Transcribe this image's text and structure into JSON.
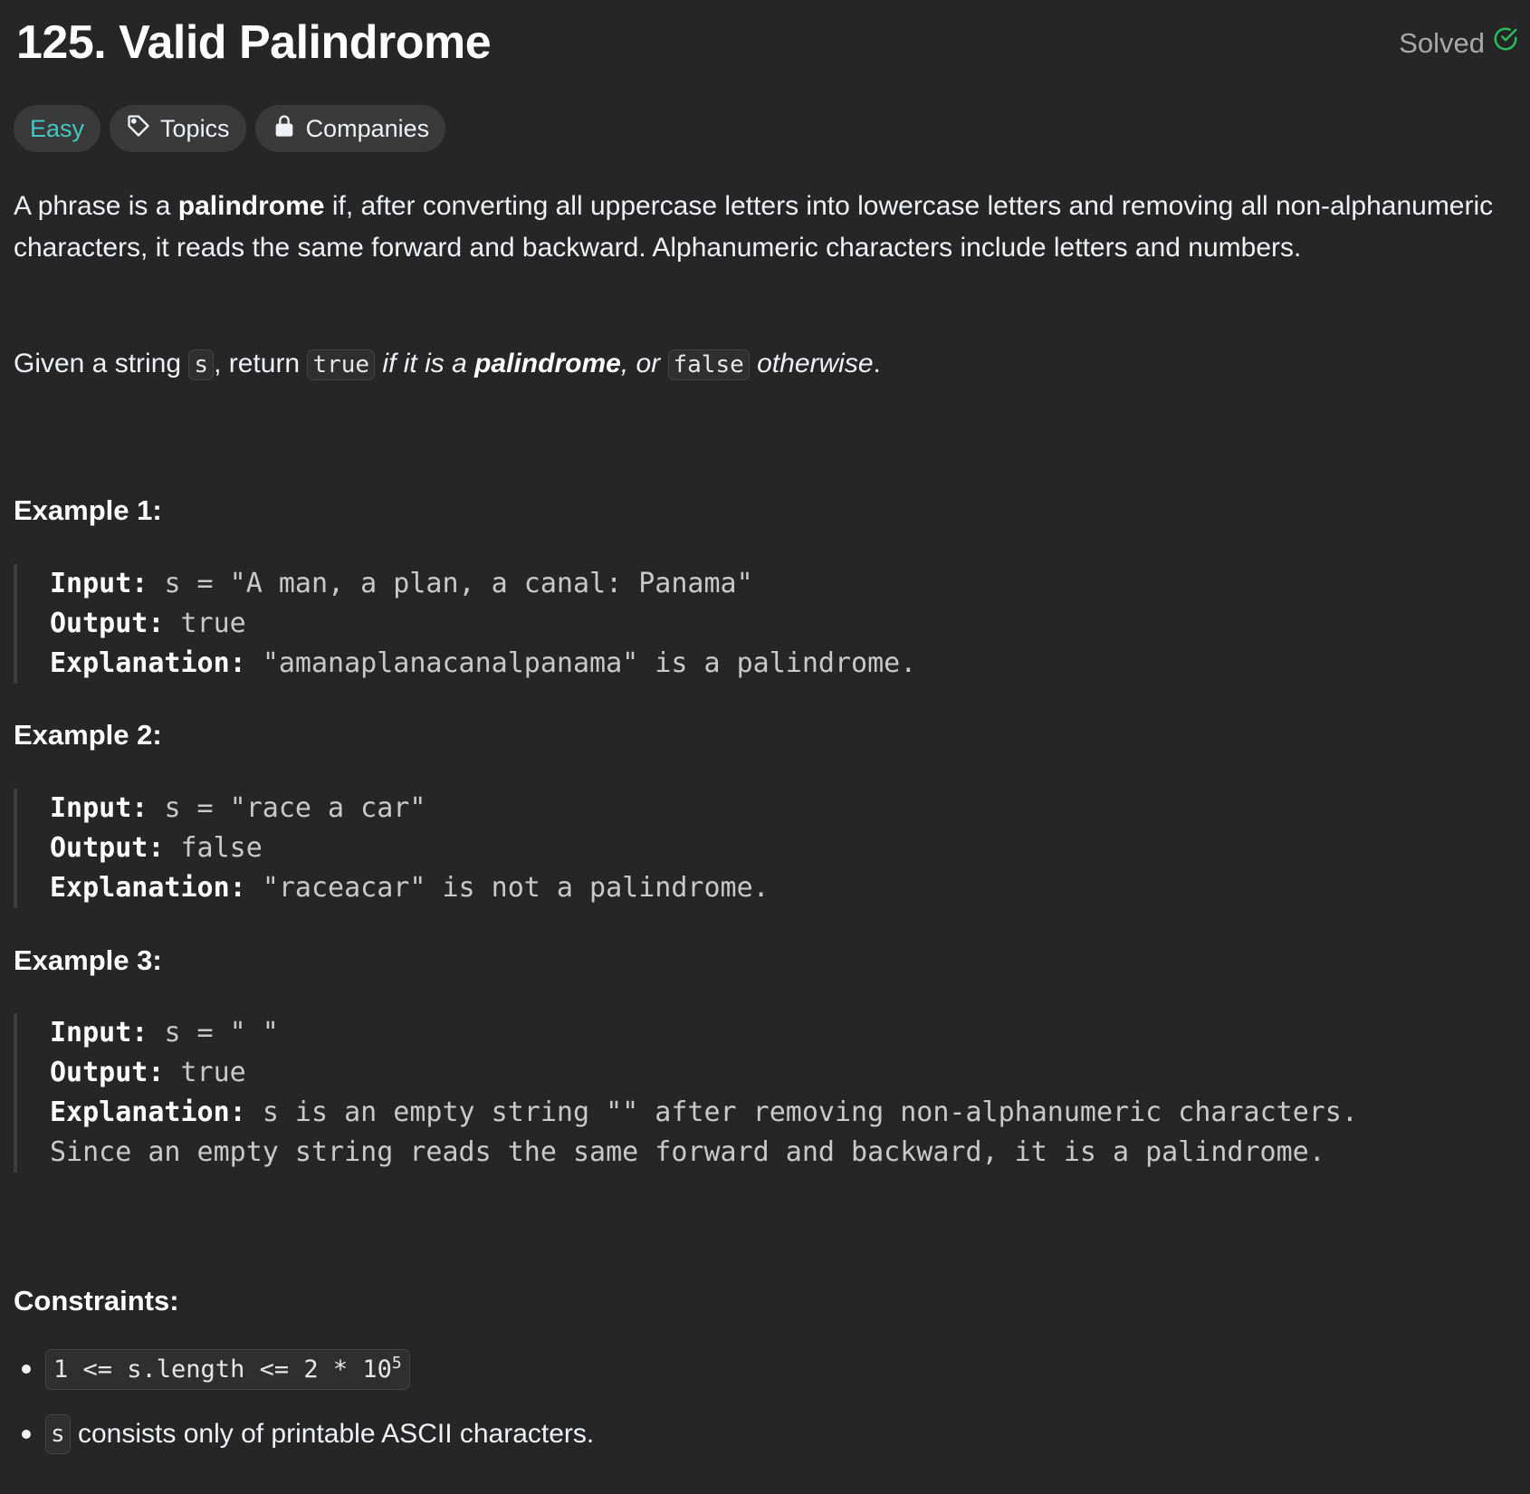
{
  "problem": {
    "title": "125. Valid Palindrome",
    "solved_label": "Solved",
    "difficulty": "Easy",
    "topics_label": "Topics",
    "companies_label": "Companies"
  },
  "description": {
    "p1_a": "A phrase is a ",
    "p1_bold": "palindrome",
    "p1_b": " if, after converting all uppercase letters into lowercase letters and removing all non-alphanumeric characters, it reads the same forward and backward. Alphanumeric characters include letters and numbers.",
    "p2_a": "Given a string ",
    "p2_code_s": "s",
    "p2_b": ", return ",
    "p2_code_true": "true",
    "p2_c": " if it is a ",
    "p2_bold": "palindrome",
    "p2_d": ", or ",
    "p2_code_false": "false",
    "p2_e": " otherwise",
    "p2_f": "."
  },
  "examples": [
    {
      "heading": "Example 1:",
      "input_label": "Input:",
      "input": "s = \"A man, a plan, a canal: Panama\"",
      "output_label": "Output:",
      "output": "true",
      "explanation_label": "Explanation:",
      "explanation": "\"amanaplanacanalpanama\" is a palindrome."
    },
    {
      "heading": "Example 2:",
      "input_label": "Input:",
      "input": "s = \"race a car\"",
      "output_label": "Output:",
      "output": "false",
      "explanation_label": "Explanation:",
      "explanation": "\"raceacar\" is not a palindrome."
    },
    {
      "heading": "Example 3:",
      "input_label": "Input:",
      "input": "s = \" \"",
      "output_label": "Output:",
      "output": "true",
      "explanation_label": "Explanation:",
      "explanation": "s is an empty string \"\" after removing non-alphanumeric characters.",
      "explanation_line2": "Since an empty string reads the same forward and backward, it is a palindrome."
    }
  ],
  "constraints": {
    "heading": "Constraints:",
    "c1_code": "1 <= s.length <= 2 * 10",
    "c1_sup": "5",
    "c2_code": "s",
    "c2_text": " consists only of printable ASCII characters."
  },
  "colors": {
    "background": "#262626",
    "easy": "#46c6c2",
    "solved_check": "#2cbb5d",
    "tag_bg": "#3a3a3a"
  },
  "icons": {
    "solved": "check-circle-icon",
    "topics": "tag-icon",
    "companies": "lock-icon"
  }
}
